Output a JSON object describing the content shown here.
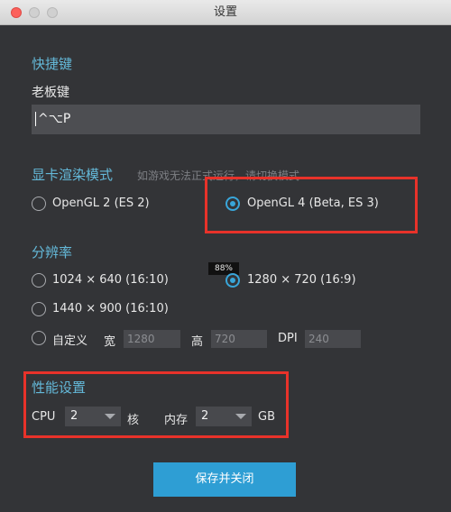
{
  "window": {
    "title": "设置"
  },
  "hotkey": {
    "section_title": "快捷键",
    "boss_key_label": "老板键",
    "boss_key_value": "^⌥P"
  },
  "render": {
    "section_title": "显卡渲染模式",
    "hint": "如游戏无法正式运行，请切换模式",
    "options": [
      {
        "label": "OpenGL 2 (ES 2)",
        "selected": false
      },
      {
        "label": "OpenGL 4 (Beta, ES 3)",
        "selected": true
      }
    ]
  },
  "tooltip": {
    "text": "88%"
  },
  "resolution": {
    "section_title": "分辨率",
    "options": [
      {
        "label": "1024 × 640 (16:10)",
        "selected": false
      },
      {
        "label": "1280 × 720 (16:9)",
        "selected": true
      },
      {
        "label": "1440 × 900 (16:10)",
        "selected": false
      },
      {
        "label": "自定义",
        "selected": false
      }
    ],
    "custom": {
      "width_label": "宽",
      "width_value": "1280",
      "height_label": "高",
      "height_value": "720",
      "dpi_label": "DPI",
      "dpi_value": "240"
    }
  },
  "performance": {
    "section_title": "性能设置",
    "cpu_label": "CPU",
    "cpu_value": "2",
    "cpu_unit": "核",
    "mem_label": "内存",
    "mem_value": "2",
    "mem_unit": "GB"
  },
  "footer": {
    "save_label": "保存并关闭"
  },
  "colors": {
    "accent": "#2e9ed4",
    "section_title": "#64b9d9",
    "highlight_box": "#e8322a",
    "background": "#333437"
  }
}
